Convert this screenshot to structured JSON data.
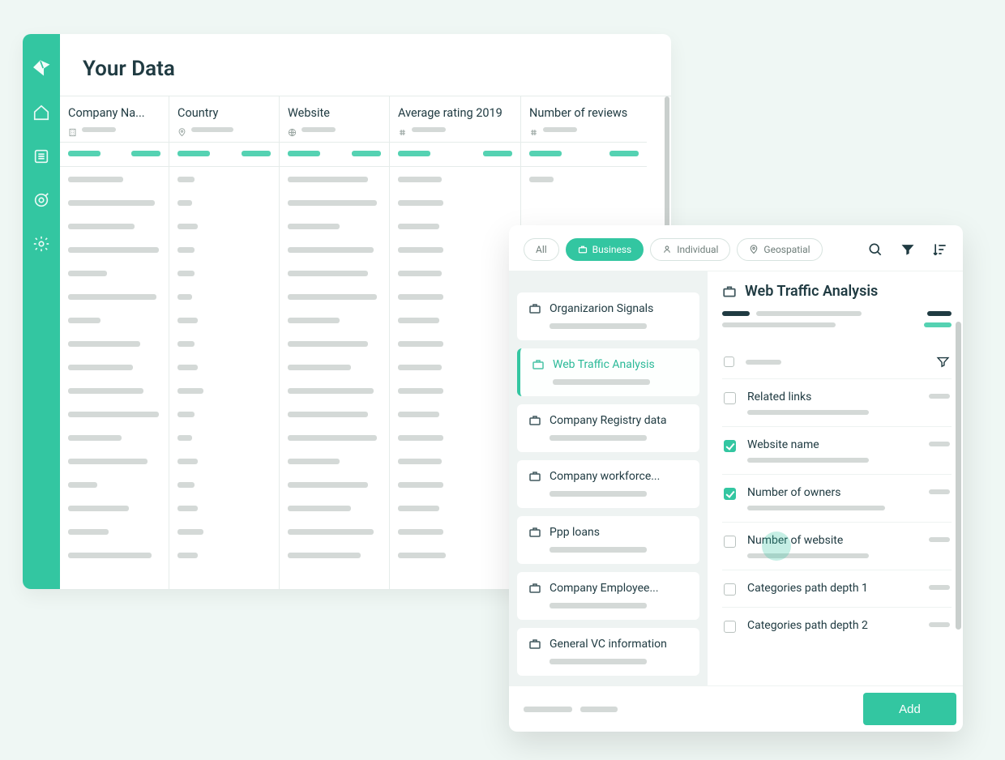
{
  "page": {
    "title": "Your Data"
  },
  "columns": [
    {
      "label": "Company Na...",
      "type_icon": "building"
    },
    {
      "label": "Country",
      "type_icon": "pin"
    },
    {
      "label": "Website",
      "type_icon": "globe"
    },
    {
      "label": "Average rating 2019",
      "type_icon": "hash"
    },
    {
      "label": "Number of reviews",
      "type_icon": "hash"
    }
  ],
  "filters": {
    "all": "All",
    "business": "Business",
    "individual": "Individual",
    "geospatial": "Geospatial"
  },
  "categories": [
    {
      "label": "Organizarion Signals"
    },
    {
      "label": "Web Traffic Analysis",
      "active": true
    },
    {
      "label": "Company Registry data"
    },
    {
      "label": "Company workforce..."
    },
    {
      "label": "Ppp loans"
    },
    {
      "label": "Company Employee..."
    },
    {
      "label": "General VC information"
    }
  ],
  "detail": {
    "title": "Web Traffic Analysis",
    "signals": [
      {
        "label": "Related links",
        "checked": false
      },
      {
        "label": "Website name",
        "checked": true
      },
      {
        "label": "Number of owners",
        "checked": true
      },
      {
        "label": "Number of website",
        "checked": false
      },
      {
        "label": "Categories path depth 1",
        "checked": false
      },
      {
        "label": "Categories path depth 2",
        "checked": false
      }
    ]
  },
  "buttons": {
    "add": "Add"
  }
}
